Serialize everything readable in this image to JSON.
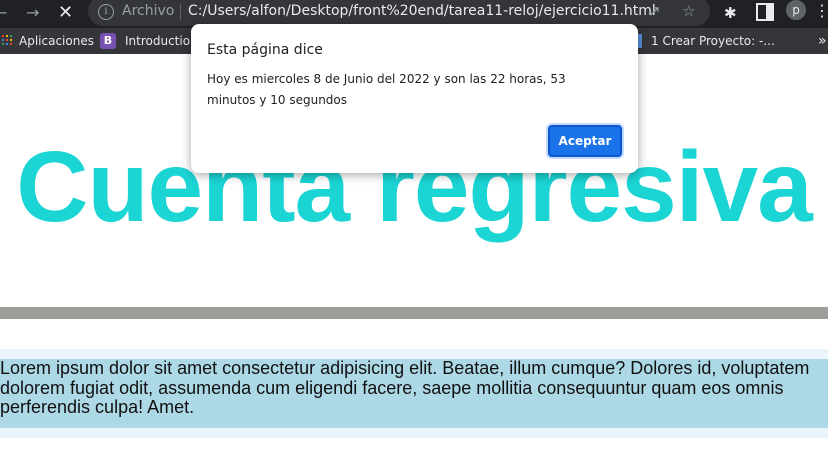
{
  "browser": {
    "address_label": "Archivo",
    "url": "C:/Users/alfon/Desktop/front%20end/tarea11-reloj/ejercicio11.html",
    "profile_initial": "p",
    "bookmarks": [
      {
        "label": "Aplicaciones",
        "icon": "apps-grid-icon"
      },
      {
        "label": "Introduction",
        "icon": "bootstrap-icon"
      },
      {
        "label": "1 Crear Proyecto: -...",
        "icon": "page-icon"
      }
    ]
  },
  "page": {
    "heading": "Cuenta regresiva",
    "heading_color": "#1bd4d4",
    "paragraph": "Lorem ipsum dolor sit amet consectetur adipisicing elit. Beatae, illum cumque? Dolores id, voluptatem dolorem fugiat odit, assumenda cum eligendi facere, saepe mollitia consequuntur quam eos omnis perferendis culpa! Amet.",
    "paragraph_bg": "#add8e6",
    "bar_color": "#9d9e99"
  },
  "dialog": {
    "title": "Esta página dice",
    "message": "Hoy es miercoles  8 de Junio del 2022 y son las 22 horas, 53 minutos y 10 segundos",
    "accept_label": "Aceptar"
  }
}
